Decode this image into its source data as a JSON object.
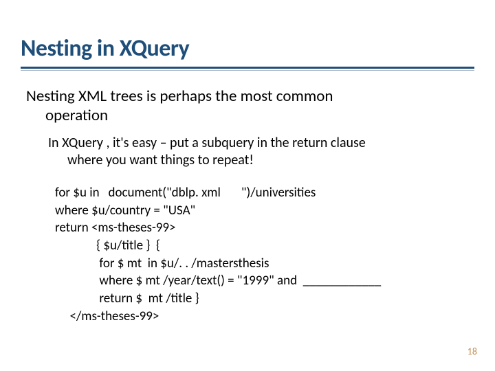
{
  "title": "Nesting in XQuery",
  "body": {
    "line1": "Nesting XML trees is perhaps the most common",
    "line2": "operation"
  },
  "sub": {
    "line1": "In  XQuery , it's easy – put a    subquery   in the  return   clause",
    "line2": "where you want things to repeat!"
  },
  "code": {
    "l1": "for $u in   document(\"dblp. xml       \")/universities",
    "l2": "where $u/country = \"USA\"",
    "l3": "return <ms-theses-99>",
    "l4": "              { $u/title }  {",
    "l5": "               for $ mt  in $u/. . /mastersthesis",
    "l6": "               where $ mt /year/text() = \"1999\" and  ____________",
    "l7": "               return $  mt /title }",
    "l8": "     </ms-theses-99>"
  },
  "page": "18"
}
